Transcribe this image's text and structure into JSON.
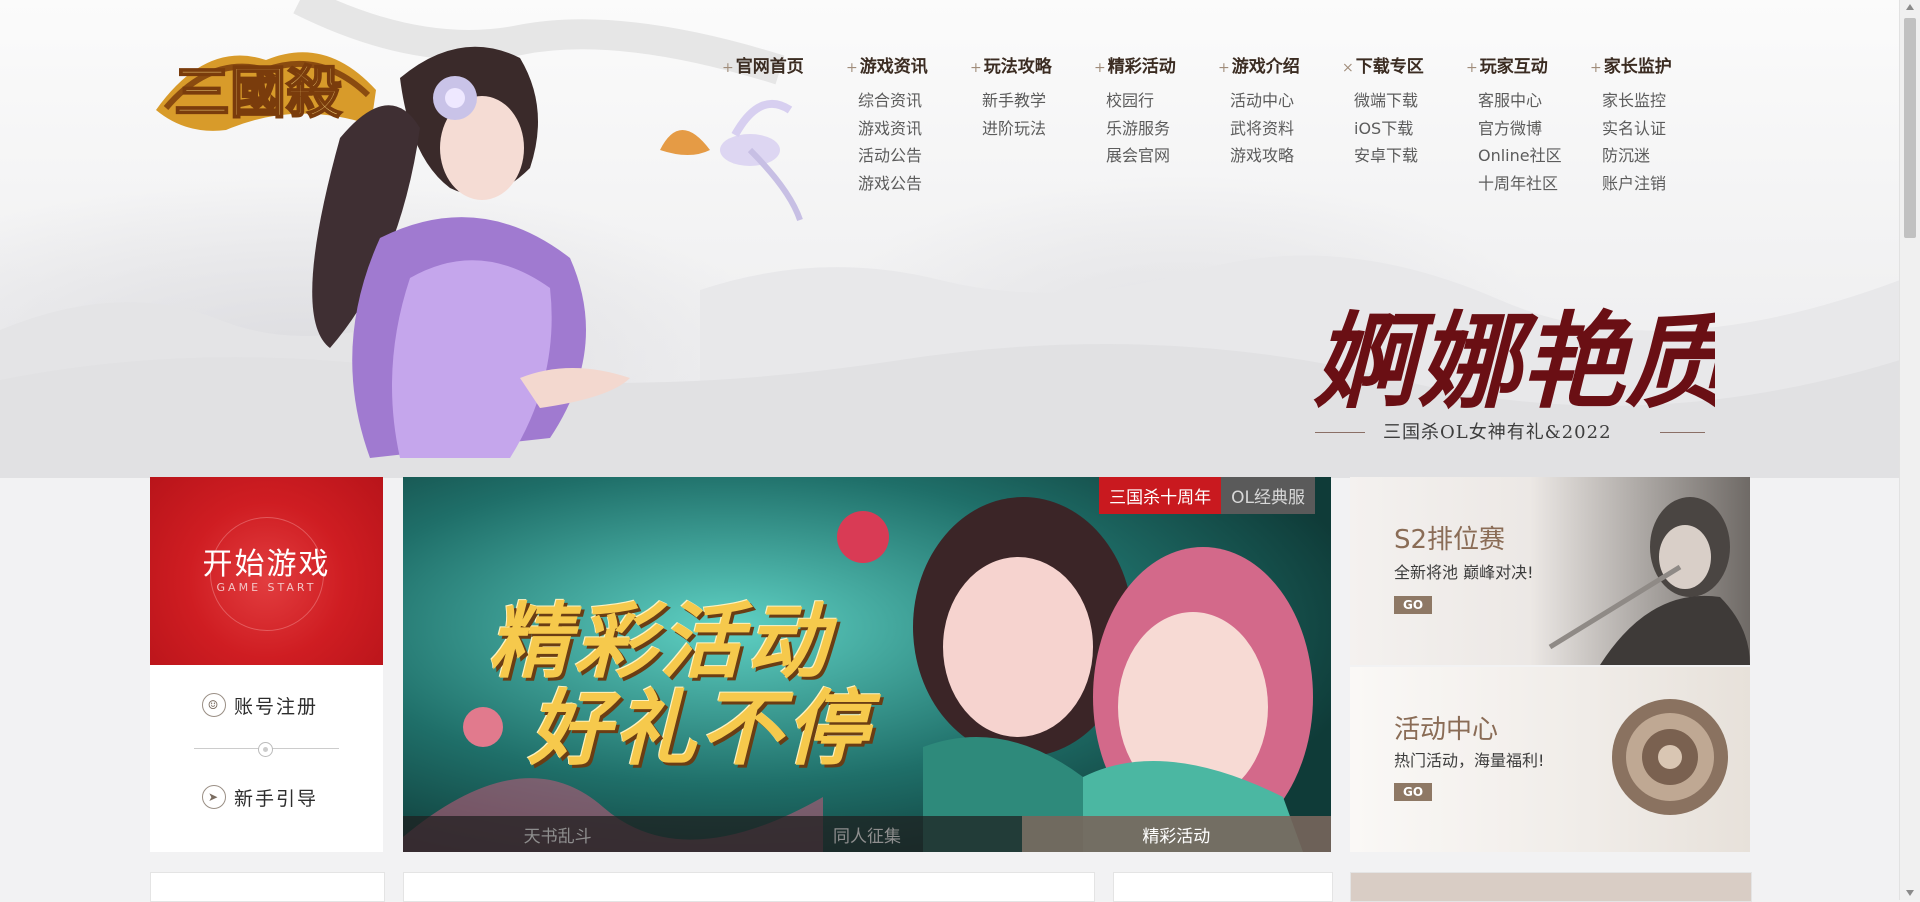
{
  "logo": {
    "text": "三國殺"
  },
  "nav": [
    {
      "title": "官网首页",
      "items": []
    },
    {
      "title": "游戏资讯",
      "items": [
        "综合资讯",
        "游戏资讯",
        "活动公告",
        "游戏公告"
      ]
    },
    {
      "title": "玩法攻略",
      "items": [
        "新手教学",
        "进阶玩法"
      ]
    },
    {
      "title": "精彩活动",
      "items": [
        "校园行",
        "乐游服务",
        "展会官网"
      ]
    },
    {
      "title": "游戏介绍",
      "items": [
        "活动中心",
        "武将资料",
        "游戏攻略"
      ]
    },
    {
      "title": "下载专区",
      "items": [
        "微端下载",
        "iOS下载",
        "安卓下载"
      ]
    },
    {
      "title": "玩家互动",
      "items": [
        "客服中心",
        "官方微博",
        "Online社区",
        "十周年社区"
      ]
    },
    {
      "title": "家长监护",
      "items": [
        "家长监控",
        "实名认证",
        "防沉迷",
        "账户注销"
      ]
    }
  ],
  "slogan": {
    "main": "婀娜艳质",
    "sub": "三国杀OL女神有礼&2022"
  },
  "start": {
    "title": "开始游戏",
    "sub": "GAME START"
  },
  "side_links": {
    "register": "账号注册",
    "guide": "新手引导"
  },
  "banner": {
    "tabs": [
      "三国杀十周年",
      "OL经典服"
    ],
    "headline1": "精彩活动",
    "headline2": "好礼不停",
    "bottom_tabs": [
      "天书乱斗",
      "同人征集",
      "精彩活动"
    ]
  },
  "promos": [
    {
      "title": "S2排位赛",
      "sub": "全新将池 巅峰对决!",
      "go": "GO"
    },
    {
      "title": "活动中心",
      "sub": "热门活动，海量福利!",
      "go": "GO"
    }
  ],
  "colors": {
    "accent_red": "#c9191f",
    "nav_text": "#3b2c22",
    "promo_brown": "#8e7865"
  }
}
